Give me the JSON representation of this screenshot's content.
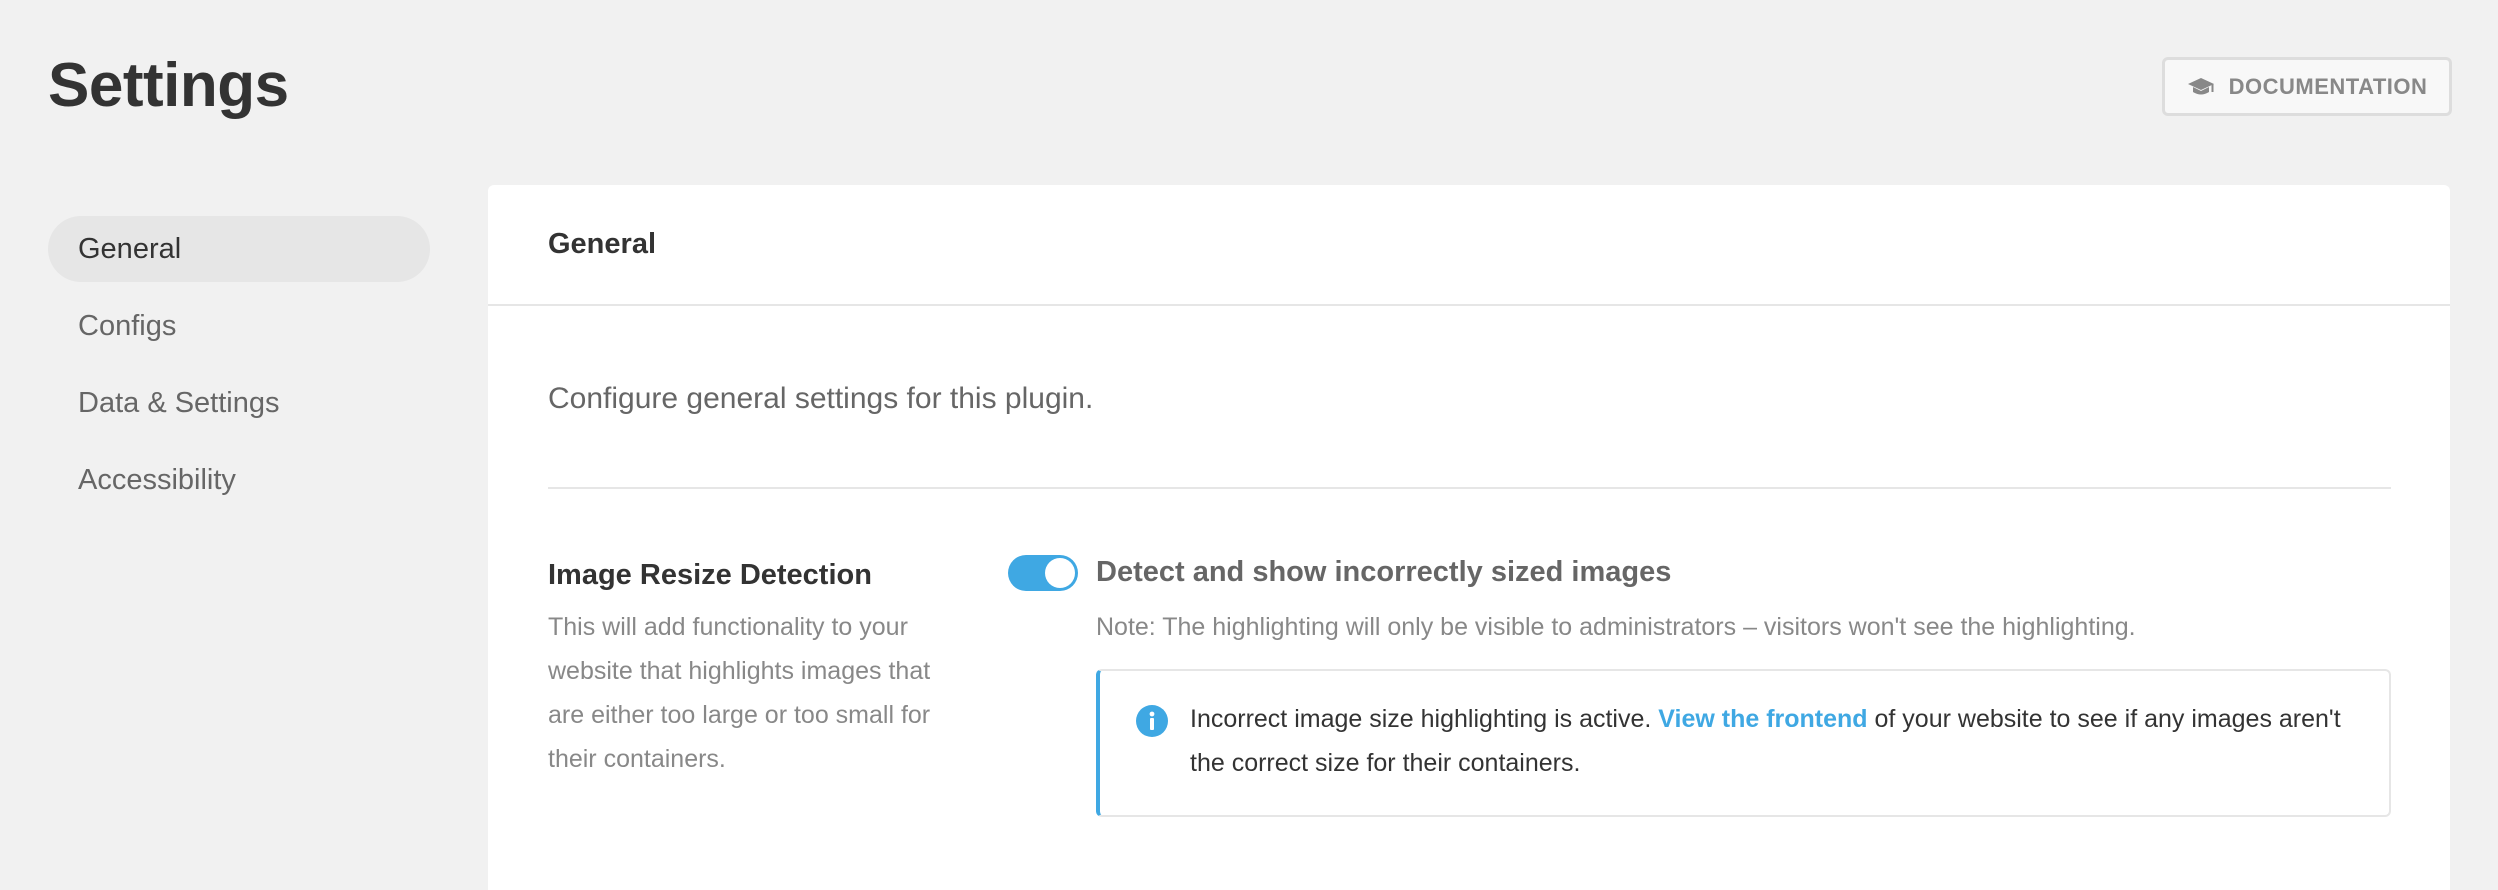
{
  "header": {
    "title": "Settings",
    "documentation_label": "DOCUMENTATION",
    "documentation_icon": "graduation-cap-icon"
  },
  "sidebar": {
    "items": [
      {
        "label": "General",
        "active": true
      },
      {
        "label": "Configs",
        "active": false
      },
      {
        "label": "Data & Settings",
        "active": false
      },
      {
        "label": "Accessibility",
        "active": false
      }
    ]
  },
  "card": {
    "title": "General",
    "intro": "Configure general settings for this plugin.",
    "setting": {
      "label": "Image Resize Detection",
      "description": "This will add functionality to your website that highlights images that are either too large or too small for their containers.",
      "toggle_label": "Detect and show incorrectly sized images",
      "toggle_on": true,
      "note": "Note: The highlighting will only be visible to administrators – visitors won't see the highlighting.",
      "notice": {
        "icon": "info-icon",
        "text_before": "Incorrect image size highlighting is active.",
        "link_text": "View the frontend",
        "text_after": "of your website to see if any images aren't the correct size for their containers."
      }
    }
  },
  "colors": {
    "accent": "#3fa8e3",
    "background": "#f1f1f1",
    "card": "#ffffff",
    "active_nav": "#e6e6e6"
  }
}
